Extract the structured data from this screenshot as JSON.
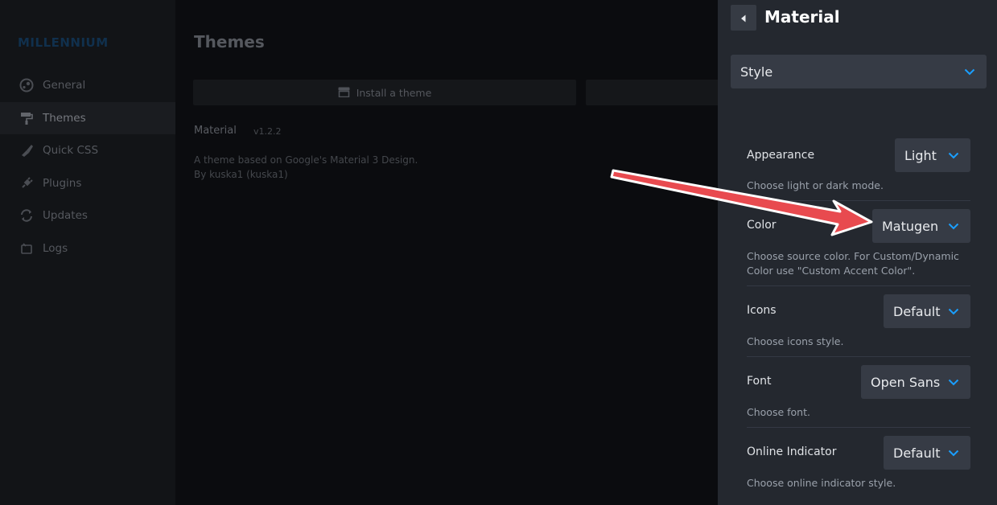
{
  "app": {
    "brand": "MILLENNIUM",
    "nav": [
      {
        "label": "General",
        "icon": "steam-icon"
      },
      {
        "label": "Themes",
        "icon": "paint-roller-icon"
      },
      {
        "label": "Quick CSS",
        "icon": "brush-icon"
      },
      {
        "label": "Plugins",
        "icon": "plug-icon"
      },
      {
        "label": "Updates",
        "icon": "refresh-icon"
      },
      {
        "label": "Logs",
        "icon": "log-icon"
      }
    ],
    "active_nav": "Themes",
    "page_title": "Themes",
    "install_button": "Install a theme",
    "theme": {
      "name": "Material",
      "version": "v1.2.2",
      "description": "A theme based on Google's Material 3 Design.",
      "author": "By kuska1 (kuska1)"
    }
  },
  "panel": {
    "title": "Material",
    "section_dropdown": "Style",
    "settings": [
      {
        "label": "Appearance",
        "value": "Light",
        "description": "Choose light or dark mode."
      },
      {
        "label": "Color",
        "value": "Matugen",
        "description": "Choose source color. For Custom/Dynamic Color use \"Custom Accent Color\"."
      },
      {
        "label": "Icons",
        "value": "Default",
        "description": "Choose icons style."
      },
      {
        "label": "Font",
        "value": "Open Sans",
        "description": "Choose font."
      },
      {
        "label": "Online Indicator",
        "value": "Default",
        "description": "Choose online indicator style."
      }
    ]
  },
  "colors": {
    "accent_chevron": "#1a9fff",
    "annotation_arrow": "#e84a4f",
    "panel_bg": "#24282f"
  }
}
